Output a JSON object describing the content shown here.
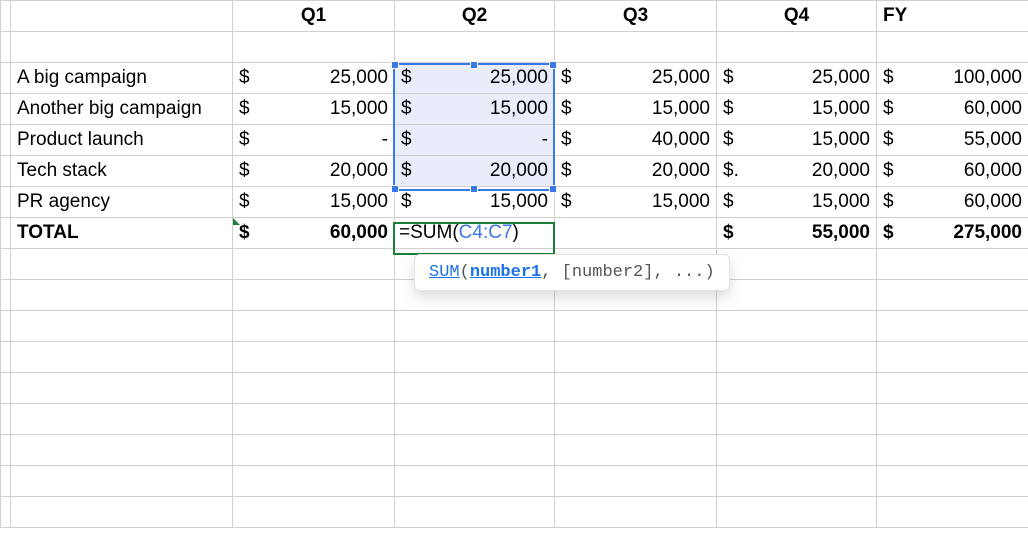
{
  "headers": {
    "q1": "Q1",
    "q2": "Q2",
    "q3": "Q3",
    "q4": "Q4",
    "fy": "FY"
  },
  "rows": [
    {
      "label": "A big campaign",
      "q1": "25,000",
      "q2": "25,000",
      "q3": "25,000",
      "q4": "25,000",
      "fy": "100,000"
    },
    {
      "label": "Another big campaign",
      "q1": "15,000",
      "q2": "15,000",
      "q3": "15,000",
      "q4": "15,000",
      "fy": "60,000"
    },
    {
      "label": "Product launch",
      "q1": "-",
      "q2": "-",
      "q3": "40,000",
      "q4": "15,000",
      "fy": "55,000"
    },
    {
      "label": "Tech stack",
      "q1": "20,000",
      "q2": "20,000",
      "q3": "20,000",
      "q4_sym": "$.",
      "q4": "20,000",
      "fy": "60,000"
    },
    {
      "label": "PR agency",
      "q1": "15,000",
      "q2": "15,000",
      "q3": "15,000",
      "q4": "15,000",
      "fy": "60,000"
    }
  ],
  "currency": "$",
  "total": {
    "label": "TOTAL",
    "q1": "60,000",
    "q2_formula": "=SUM(C4:C7)",
    "q3": "",
    "q4": "55,000",
    "fy": "275,000"
  },
  "formula_parts": {
    "eq": "=",
    "fn": "SUM",
    "open": "(",
    "ref": "C4:C7",
    "close": ")"
  },
  "tooltip": {
    "fn": "SUM",
    "open": "(",
    "arg1": "number1",
    "rest": ", [number2], ...)"
  }
}
